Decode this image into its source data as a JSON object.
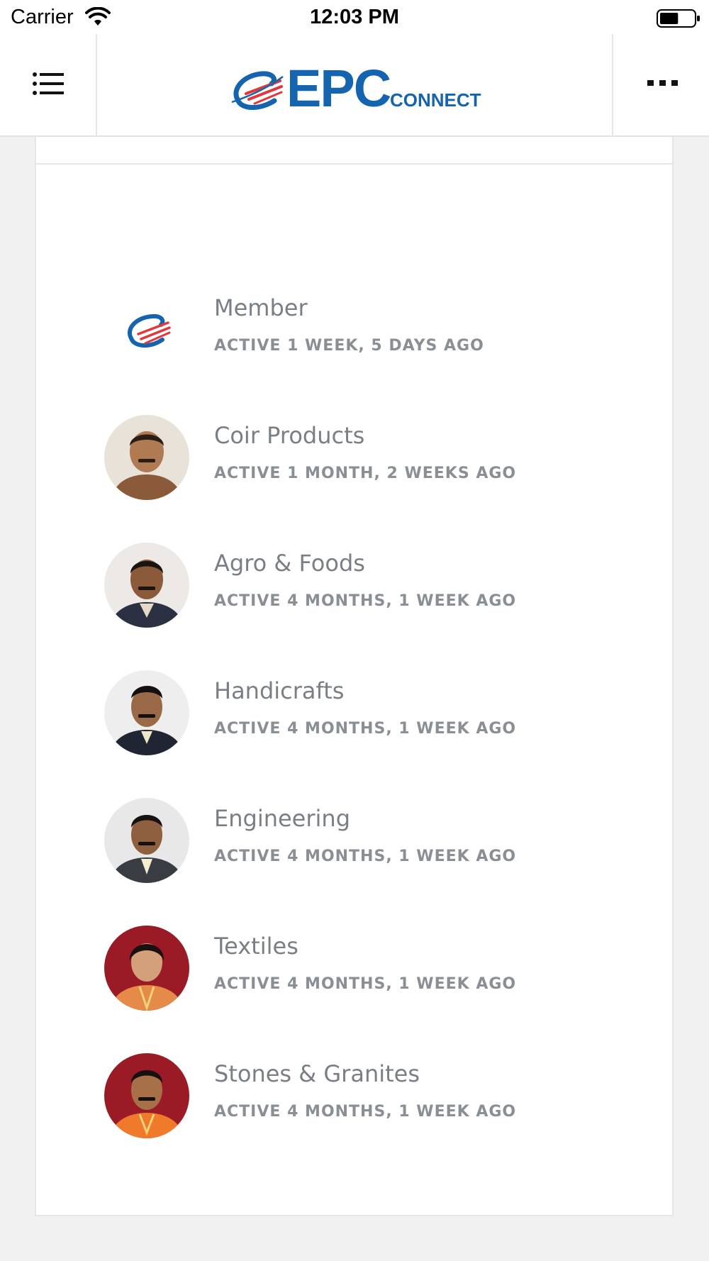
{
  "status_bar": {
    "carrier": "Carrier",
    "time": "12:03 PM",
    "battery_level": 0.55
  },
  "header": {
    "logo_text": "EPC",
    "logo_subtext": "CONNECT",
    "brand_color": "#1564b0",
    "accent_color": "#e0383c",
    "menu_icon": "list-icon",
    "more_icon": "more-icon"
  },
  "members": [
    {
      "name": "Member",
      "status": "ACTIVE 1 WEEK, 5 DAYS AGO",
      "avatar": "epc-logo",
      "bg": "#ffffff"
    },
    {
      "name": "Coir Products",
      "status": "ACTIVE 1 MONTH, 2 WEEKS AGO",
      "avatar": "person-photo",
      "bg": "#e9e2d8"
    },
    {
      "name": "Agro & Foods",
      "status": "ACTIVE 4 MONTHS, 1 WEEK AGO",
      "avatar": "person-photo",
      "bg": "#ece9e6"
    },
    {
      "name": "Handicrafts",
      "status": "ACTIVE 4 MONTHS, 1 WEEK AGO",
      "avatar": "person-photo",
      "bg": "#eeeeee"
    },
    {
      "name": "Engineering",
      "status": "ACTIVE 4 MONTHS, 1 WEEK AGO",
      "avatar": "person-photo",
      "bg": "#e8e8e8"
    },
    {
      "name": "Textiles",
      "status": "ACTIVE 4 MONTHS, 1 WEEK AGO",
      "avatar": "person-photo",
      "bg": "#9a1b25"
    },
    {
      "name": "Stones & Granites",
      "status": "ACTIVE 4 MONTHS, 1 WEEK AGO",
      "avatar": "person-photo",
      "bg": "#9a1b25"
    }
  ]
}
